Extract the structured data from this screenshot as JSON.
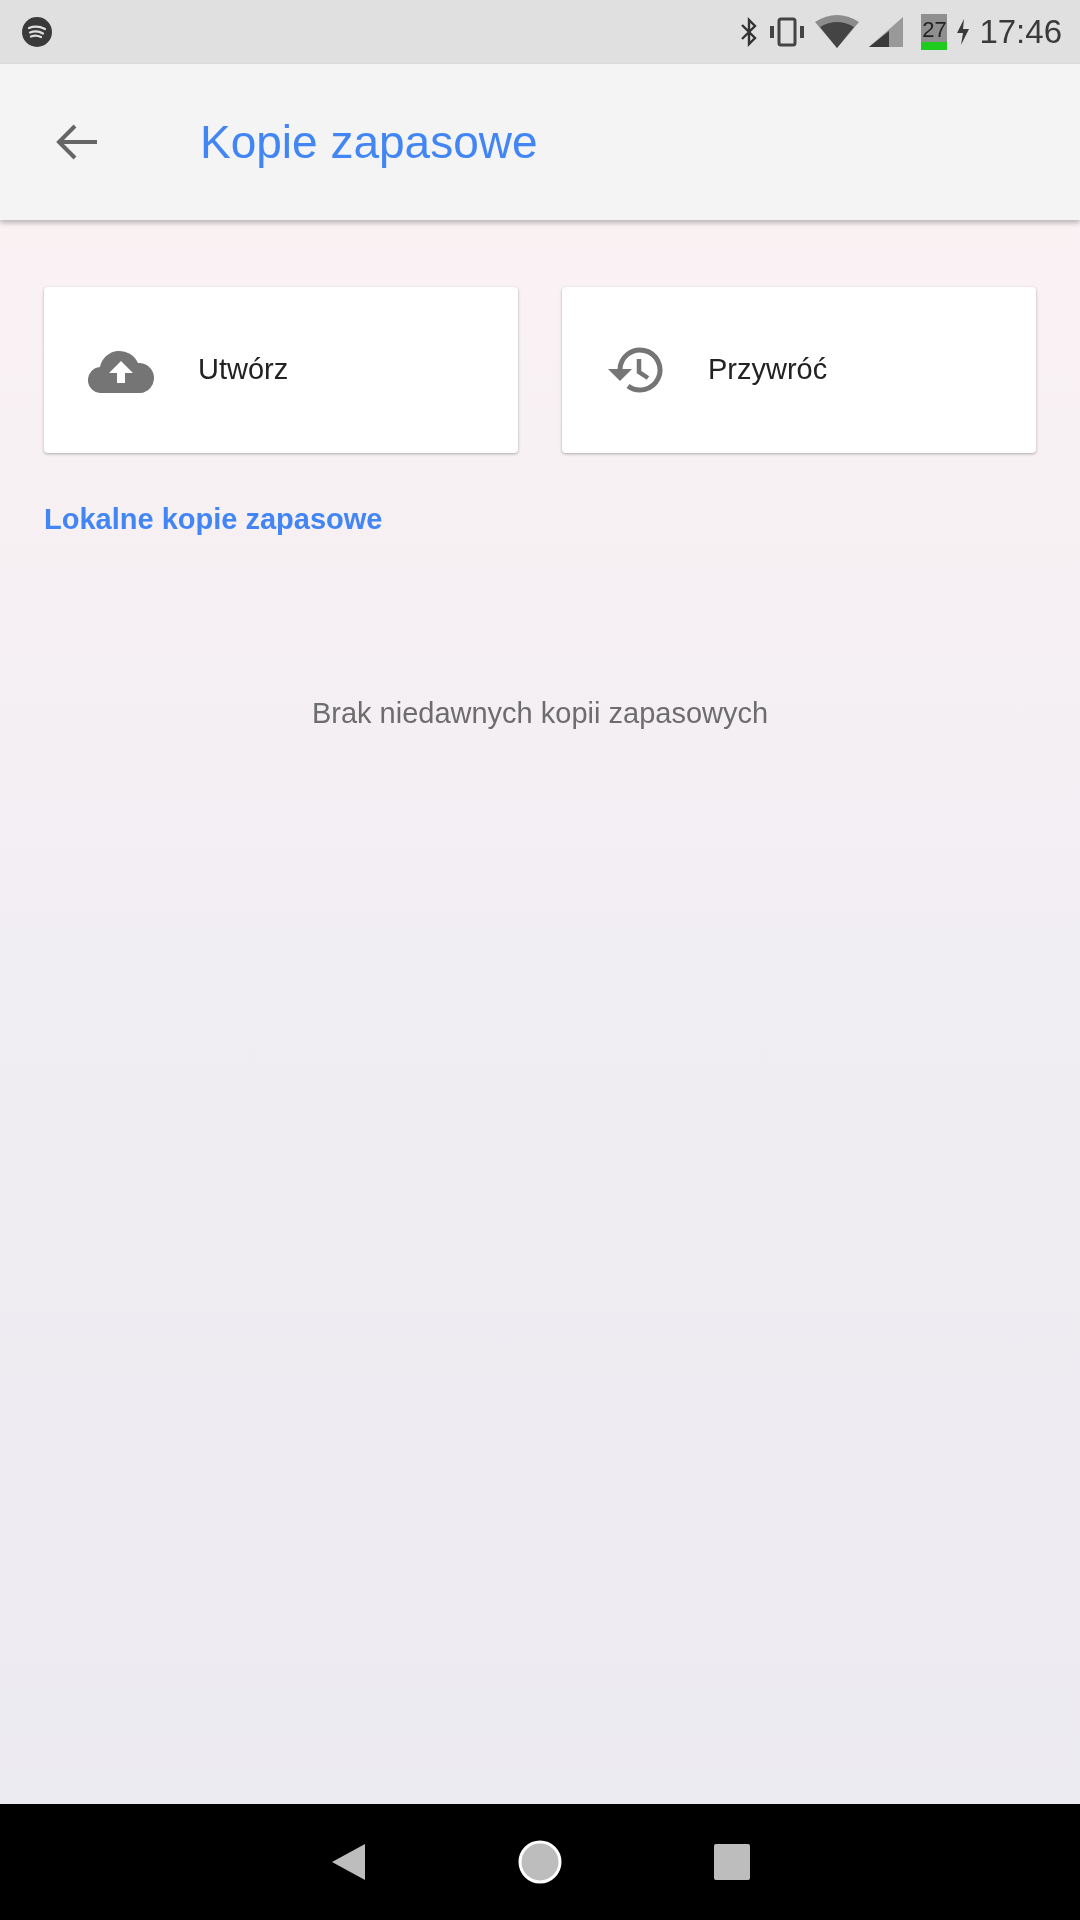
{
  "status_bar": {
    "battery": "27",
    "time": "17:46"
  },
  "app_bar": {
    "title": "Kopie zapasowe"
  },
  "actions": [
    {
      "kind": "upload",
      "label": "Utwórz"
    },
    {
      "kind": "restore",
      "label": "Przywróć"
    }
  ],
  "section_link": "Lokalne kopie zapasowe",
  "empty_message": "Brak niedawnych kopii zapasowych"
}
